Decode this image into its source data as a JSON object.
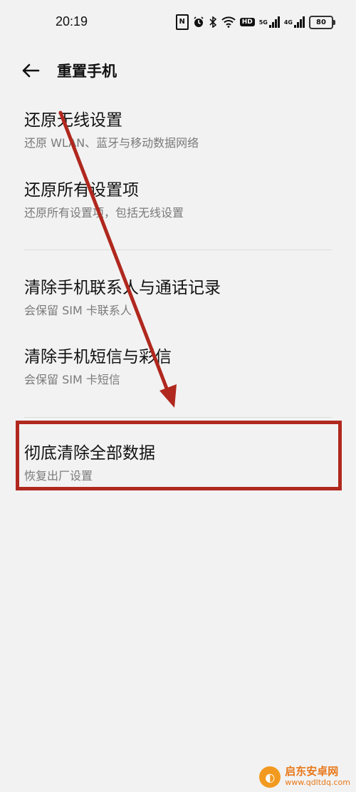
{
  "status_bar": {
    "time": "20:19",
    "icons": [
      "nfc-icon",
      "alarm-icon",
      "bluetooth-icon",
      "wifi-icon",
      "hd-icon",
      "signal-5g-icon",
      "signal-4g-icon",
      "battery-icon"
    ],
    "hd_label": "HD",
    "sig1_label": "5G",
    "sig2_label": "4G",
    "battery": "80"
  },
  "header": {
    "title": "重置手机"
  },
  "options": [
    {
      "title": "还原无线设置",
      "subtitle": "还原 WLAN、蓝牙与移动数据网络"
    },
    {
      "title": "还原所有设置项",
      "subtitle": "还原所有设置项，包括无线设置"
    },
    {
      "title": "清除手机联系人与通话记录",
      "subtitle": "会保留 SIM 卡联系人"
    },
    {
      "title": "清除手机短信与彩信",
      "subtitle": "会保留 SIM 卡短信"
    },
    {
      "title": "彻底清除全部数据",
      "subtitle": "恢复出厂设置"
    }
  ],
  "colors": {
    "background": "#f2f2f2",
    "annotation_red": "#b0281e",
    "watermark_orange": "#e8781a"
  },
  "watermark": {
    "name": "启东安卓网",
    "url": "www.qdltdq.com"
  }
}
